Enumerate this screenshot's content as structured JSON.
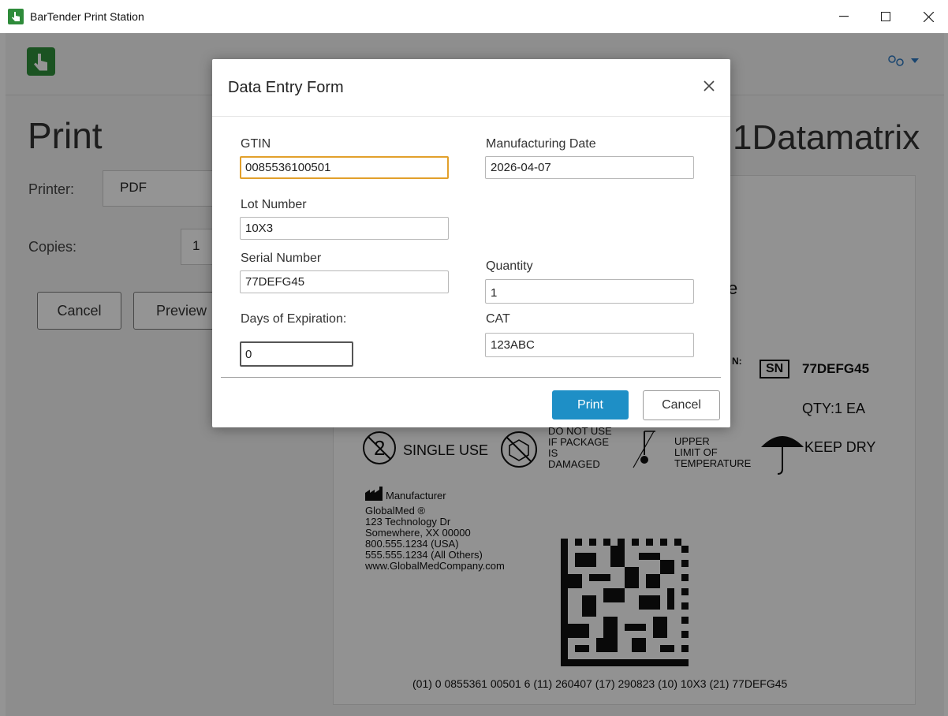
{
  "window": {
    "title": "BarTender Print Station"
  },
  "print_panel": {
    "title": "Print",
    "printer_label": "Printer:",
    "printer_value": "PDF",
    "copies_label": "Copies:",
    "copies_value": "1",
    "cancel_label": "Cancel",
    "preview_label": "Preview"
  },
  "template_name": "1Datamatrix",
  "label_preview": {
    "partial_e": "e",
    "partial_n": "N:",
    "sn_box": "SN",
    "sn_value": "77DEFG45",
    "qty": "QTY:1 EA",
    "single_use": "SINGLE USE",
    "do_not_use": [
      "DO NOT USE",
      "IF PACKAGE",
      "IS",
      "DAMAGED"
    ],
    "upper_limit": [
      "UPPER",
      "LIMIT OF",
      "TEMPERATURE"
    ],
    "keep_dry": "KEEP DRY",
    "manufacturer_label": "Manufacturer",
    "company": "GlobalMed ®",
    "address": [
      "123 Technology Dr",
      "Somewhere, XX 00000",
      "800.555.1234 (USA)",
      "555.555.1234 (All Others)",
      "www.GlobalMedCompany.com"
    ],
    "barcode_text": "(01) 0 0855361 00501 6 (11) 260407 (17) 290823 (10) 10X3 (21) 77DEFG45"
  },
  "dialog": {
    "title": "Data Entry Form",
    "fields": {
      "gtin_label": "GTIN",
      "gtin_value": "0085536100501",
      "mfg_date_label": "Manufacturing Date",
      "mfg_date_value": "2026-04-07",
      "lot_label": "Lot Number",
      "lot_value": "10X3",
      "serial_label": "Serial Number",
      "serial_value": "77DEFG45",
      "quantity_label": "Quantity",
      "quantity_value": "1",
      "days_label": "Days of Expiration:",
      "days_value": "0",
      "cat_label": "CAT",
      "cat_value": "123ABC"
    },
    "print_label": "Print",
    "cancel_label": "Cancel"
  },
  "colors": {
    "accent": "#1e8fc6",
    "focus": "#e2a02b",
    "logo": "#2f8f3b"
  }
}
